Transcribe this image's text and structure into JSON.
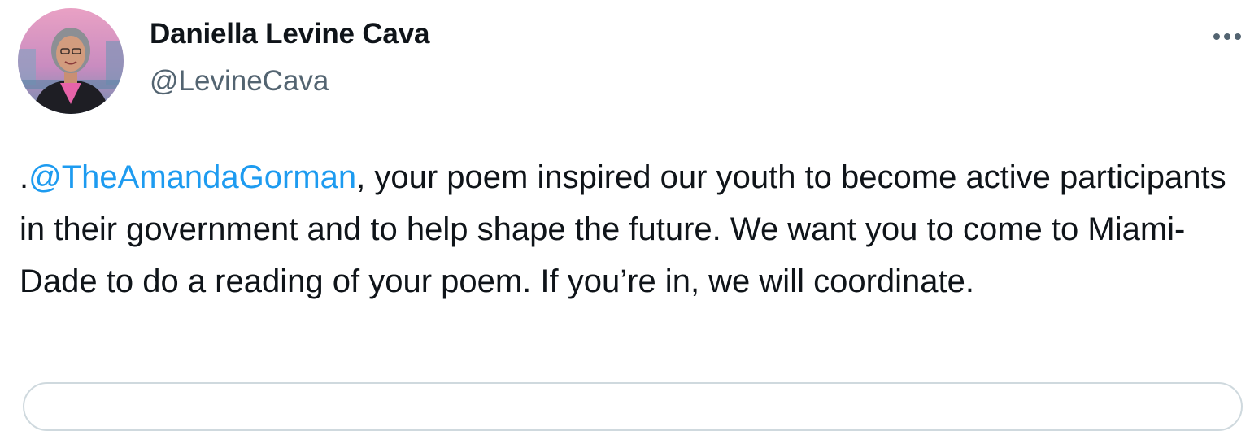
{
  "author": {
    "display_name": "Daniella Levine Cava",
    "handle": "@LevineCava",
    "avatar_icon": "profile-photo"
  },
  "more_menu": {
    "icon": "more-horizontal-icon"
  },
  "tweet": {
    "prefix": ".",
    "mention": "@TheAmandaGorman",
    "body": ", your poem inspired our youth to become active participants in their government and to help shape the future. We want you to come to Miami-Dade to do a reading of your poem. If you’re in, we will coordinate."
  },
  "colors": {
    "text": "#0f1419",
    "secondary": "#536471",
    "link": "#1d9bf0",
    "border": "#cfd9de"
  }
}
